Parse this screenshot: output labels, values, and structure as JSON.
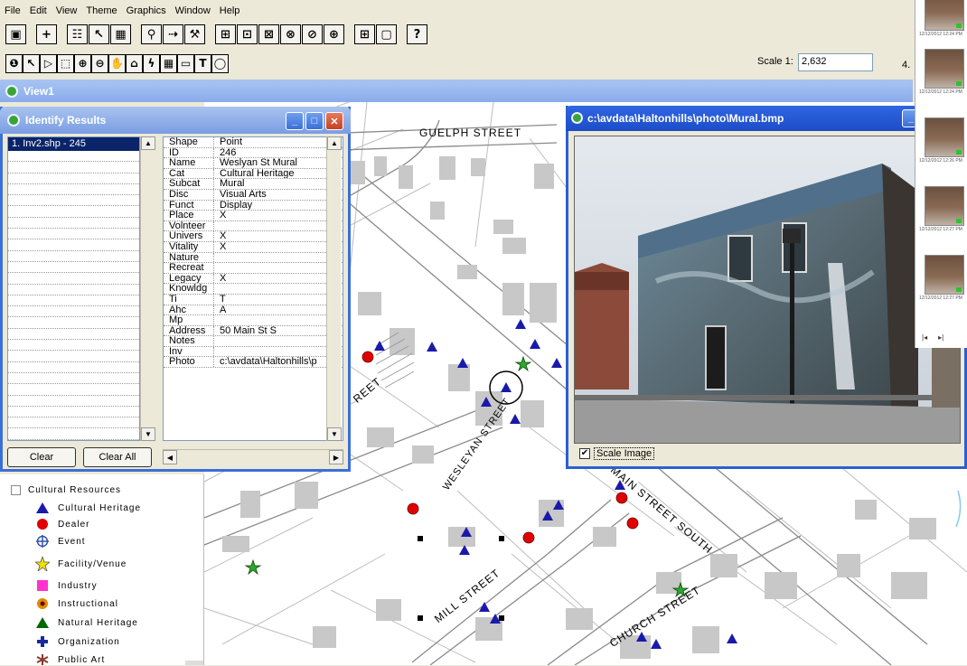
{
  "menu": [
    {
      "label": "File",
      "key": "F"
    },
    {
      "label": "Edit",
      "key": "E"
    },
    {
      "label": "View",
      "key": "V"
    },
    {
      "label": "Theme",
      "key": "T"
    },
    {
      "label": "Graphics",
      "key": "G"
    },
    {
      "label": "Window",
      "key": "W"
    },
    {
      "label": "Help",
      "key": "H"
    }
  ],
  "toolbar2": {
    "scale_label": "Scale 1:",
    "scale_value": "2,632",
    "corner_text": "4."
  },
  "view": {
    "title": "View1"
  },
  "identify": {
    "title": "Identify Results",
    "selected_item": "1. Inv2.shp - 245",
    "clear_label": "Clear",
    "clear_all_label": "Clear All",
    "fields": [
      {
        "k": "Shape",
        "v": "Point"
      },
      {
        "k": "ID",
        "v": "246"
      },
      {
        "k": "Name",
        "v": "Weslyan St Mural"
      },
      {
        "k": "Cat",
        "v": "Cultural Heritage"
      },
      {
        "k": "Subcat",
        "v": "Mural"
      },
      {
        "k": "Disc",
        "v": "Visual Arts"
      },
      {
        "k": "Funct",
        "v": "Display"
      },
      {
        "k": "Place",
        "v": "X"
      },
      {
        "k": "Volnteer",
        "v": ""
      },
      {
        "k": "Univers",
        "v": "X"
      },
      {
        "k": "Vitality",
        "v": "X"
      },
      {
        "k": "Nature",
        "v": ""
      },
      {
        "k": "Recreat",
        "v": ""
      },
      {
        "k": "Legacy",
        "v": "X"
      },
      {
        "k": "Knowldg",
        "v": ""
      },
      {
        "k": "Ti",
        "v": "T"
      },
      {
        "k": "Ahc",
        "v": "A"
      },
      {
        "k": "Mp",
        "v": ""
      },
      {
        "k": "Address",
        "v": "50 Main St S"
      },
      {
        "k": "Notes",
        "v": ""
      },
      {
        "k": "Inv",
        "v": ""
      },
      {
        "k": "Photo",
        "v": "c:\\avdata\\Haltonhills\\p"
      }
    ]
  },
  "photo_window": {
    "title": "c:\\avdata\\Haltonhills\\photo\\Mural.bmp",
    "scale_image_label": "Scale Image",
    "scale_image_checked": "✔"
  },
  "streets": {
    "guelph": "GUELPH STREET",
    "wesleyan": "WESLEYAN STREET",
    "main_south": "MAIN STREET SOUTH",
    "mill": "MILL STREET",
    "church": "CHURCH STREET",
    "partial": "REET"
  },
  "legend": {
    "group_label": "Cultural Resources",
    "items": [
      {
        "label": "Cultural Heritage",
        "symbol": "blue-triangle",
        "color": "#1a1aaa"
      },
      {
        "label": "Dealer",
        "symbol": "red-circle",
        "color": "#e00000"
      },
      {
        "label": "Event",
        "symbol": "crosshair-circle",
        "color": "#3355aa"
      },
      {
        "label": "Facility/Venue",
        "symbol": "yellow-star",
        "color": "#f2e200"
      },
      {
        "label": "Industry",
        "symbol": "magenta-square",
        "color": "#ff33cc"
      },
      {
        "label": "Instructional",
        "symbol": "orange-target",
        "color": "#e08a00"
      },
      {
        "label": "Natural Heritage",
        "symbol": "green-triangle",
        "color": "#006600"
      },
      {
        "label": "Organization",
        "symbol": "blue-cross",
        "color": "#1a2a9a"
      },
      {
        "label": "Public Art",
        "symbol": "brown-asterisk",
        "color": "#8a3a2a"
      }
    ]
  },
  "thumbnails": [
    {
      "caption": "12/12/2012 12:24 PM"
    },
    {
      "caption": "12/12/2012 12:24 PM"
    },
    {
      "caption": "12/12/2012 12:26 PM"
    },
    {
      "caption": "12/12/2012 12:27 PM"
    },
    {
      "caption": "12/12/2012 12:27 PM"
    }
  ],
  "colors": {
    "title_blue": "#2f66e3",
    "cultural_heritage": "#1a1aaa",
    "dealer": "#e00000",
    "facility": "#2a8a2a"
  }
}
